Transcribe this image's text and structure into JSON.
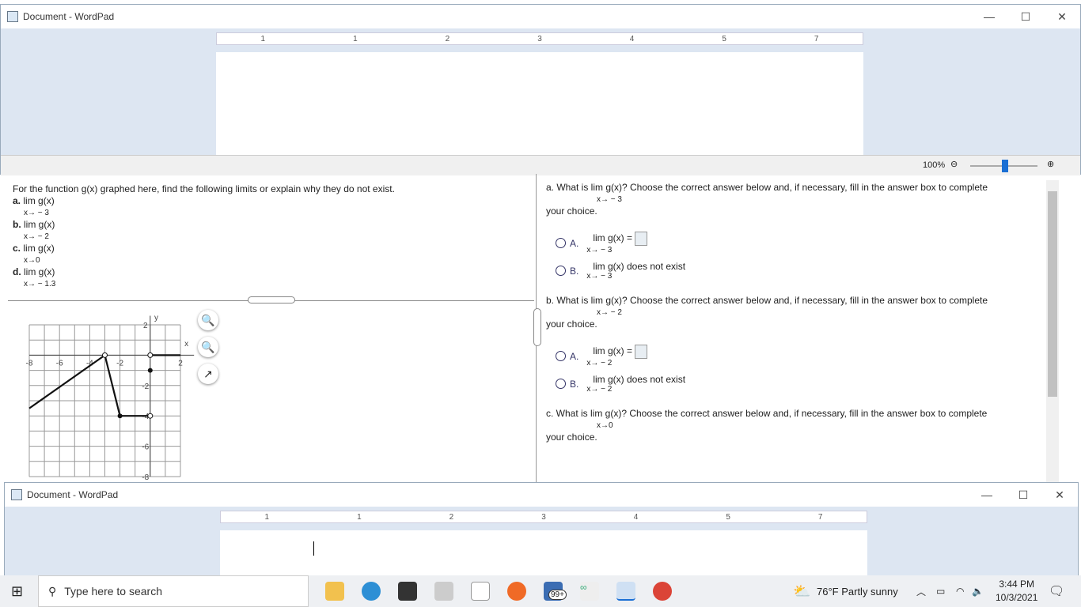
{
  "window_top": {
    "title": "Document - WordPad",
    "zoom": "100%"
  },
  "window_bottom": {
    "title": "Document - WordPad"
  },
  "ruler_labels": [
    "1",
    "1",
    "2",
    "3",
    "4",
    "5",
    "7"
  ],
  "question": {
    "intro": "For the function g(x) graphed here, find the following limits or explain why they do not exist.",
    "items": [
      {
        "label": "a.",
        "expr": "lim  g(x)",
        "sub": "x→ − 3"
      },
      {
        "label": "b.",
        "expr": "lim  g(x)",
        "sub": "x→ − 2"
      },
      {
        "label": "c.",
        "expr": "lim g(x)",
        "sub": "x→0"
      },
      {
        "label": "d.",
        "expr": "lim  g(x)",
        "sub": "x→ − 1.3"
      }
    ]
  },
  "graph": {
    "x_label": "x",
    "y_label": "y",
    "x_ticks": [
      "-8",
      "-6",
      "-4",
      "-2",
      "2"
    ],
    "y_ticks": [
      "2",
      "-2",
      "-4",
      "-6",
      "-8"
    ],
    "xlim": [
      -8,
      2
    ],
    "ylim": [
      -8,
      2
    ],
    "segments": [
      [
        [
          -8,
          -3.5
        ],
        [
          -3,
          0
        ]
      ],
      [
        [
          -3,
          0
        ],
        [
          -2,
          -4
        ]
      ],
      [
        [
          -2,
          -4
        ],
        [
          0,
          -4
        ]
      ],
      [
        [
          0,
          0
        ],
        [
          2,
          0
        ]
      ]
    ],
    "open_points": [
      [
        -3,
        0
      ],
      [
        0,
        -4
      ],
      [
        0,
        0
      ]
    ],
    "closed_points": [
      [
        -2,
        -4
      ],
      [
        0,
        -1
      ]
    ]
  },
  "answers": [
    {
      "q": "a. What is  lim  g(x)? Choose the correct answer below and, if necessary, fill in the answer box to complete",
      "sub": "x→ − 3",
      "cont": "your choice.",
      "optA": "lim  g(x) =",
      "optB": "lim  g(x) does not exist",
      "optsub": "x→ − 3"
    },
    {
      "q": "b. What is  lim  g(x)? Choose the correct answer below and, if necessary, fill in the answer box to complete",
      "sub": "x→ − 2",
      "cont": "your choice.",
      "optA": "lim  g(x) =",
      "optB": "lim  g(x) does not exist",
      "optsub": "x→ − 2"
    },
    {
      "q": "c. What is  lim g(x)? Choose the correct answer below and, if necessary, fill in the answer box to complete",
      "sub": "x→0",
      "cont": "your choice."
    }
  ],
  "option_labels": [
    "A.",
    "B."
  ],
  "taskbar": {
    "search_placeholder": "Type here to search",
    "mail_badge": "99+",
    "weather": "76°F  Partly sunny",
    "time": "3:44 PM",
    "date": "10/3/2021"
  }
}
